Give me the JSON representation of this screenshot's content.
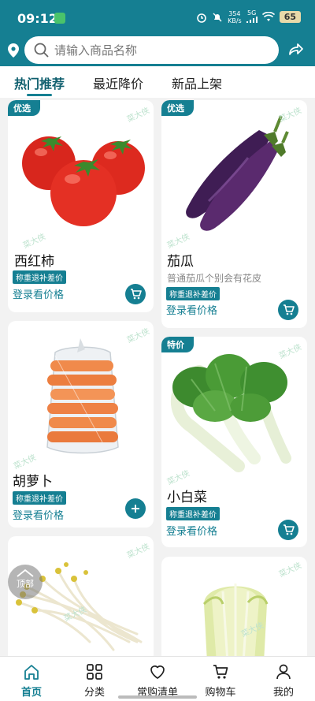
{
  "status": {
    "time": "09:12",
    "net_speed_value": "354",
    "net_speed_unit": "KB/s",
    "network": "5G",
    "battery": "65"
  },
  "search": {
    "placeholder": "请输入商品名称"
  },
  "tabs": [
    {
      "label": "热门推荐",
      "active": true
    },
    {
      "label": "最近降价",
      "active": false
    },
    {
      "label": "新品上架",
      "active": false
    }
  ],
  "watermark": "菜大侠",
  "products": [
    {
      "badge": "优选",
      "name": "西红柿",
      "desc": "",
      "tag": "称重退补差价",
      "price_text": "登录看价格",
      "action_icon": "cart-icon"
    },
    {
      "badge": "优选",
      "name": "茄瓜",
      "desc": "普通茄瓜个别会有花皮",
      "tag": "称重退补差价",
      "price_text": "登录看价格",
      "action_icon": "cart-icon"
    },
    {
      "badge": "",
      "name": "胡萝卜",
      "desc": "",
      "tag": "称重退补差价",
      "price_text": "登录看价格",
      "action_icon": "plus-icon"
    },
    {
      "badge": "特价",
      "name": "小白菜",
      "desc": "",
      "tag": "称重退补差价",
      "price_text": "登录看价格",
      "action_icon": "cart-icon"
    }
  ],
  "scroll_top": {
    "label": "顶部"
  },
  "bottom_nav": [
    {
      "label": "首页",
      "icon": "home-icon",
      "active": true
    },
    {
      "label": "分类",
      "icon": "grid-icon",
      "active": false
    },
    {
      "label": "常购清单",
      "icon": "heart-icon",
      "active": false
    },
    {
      "label": "购物车",
      "icon": "cart-icon",
      "active": false
    },
    {
      "label": "我的",
      "icon": "user-icon",
      "active": false
    }
  ],
  "colors": {
    "brand": "#157f92",
    "background": "#f2f2f2"
  }
}
